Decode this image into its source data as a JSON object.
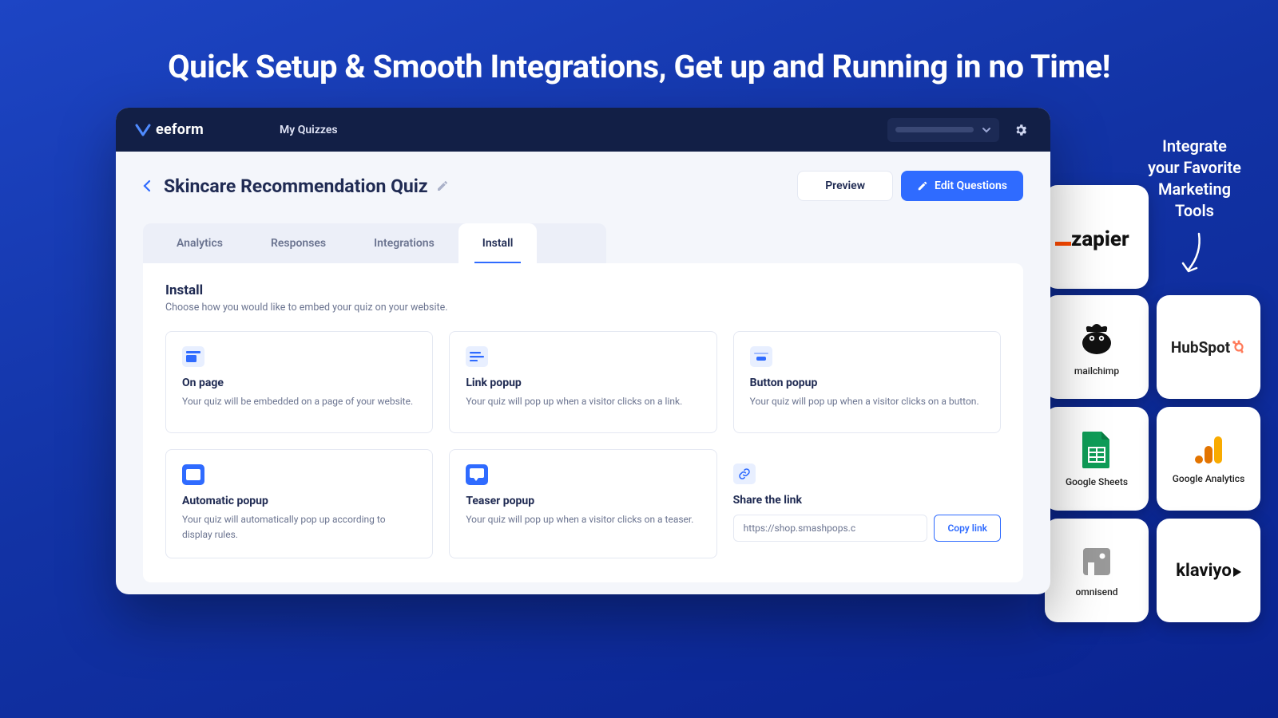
{
  "hero": "Quick Setup & Smooth Integrations, Get up and Running in no Time!",
  "callout": {
    "l1": "Integrate",
    "l2": "your Favorite",
    "l3": "Marketing",
    "l4": "Tools"
  },
  "header": {
    "brand": "eeform",
    "nav": "My Quizzes"
  },
  "title": {
    "text": "Skincare Recommendation Quiz"
  },
  "actions": {
    "preview": "Preview",
    "edit": "Edit Questions"
  },
  "tabs": {
    "analytics": "Analytics",
    "responses": "Responses",
    "integrations": "Integrations",
    "install": "Install"
  },
  "install": {
    "heading": "Install",
    "sub": "Choose how you would like to embed your quiz on your website.",
    "cards": {
      "onpage": {
        "title": "On page",
        "desc": "Your quiz will be embedded on a page of your website."
      },
      "linkpopup": {
        "title": "Link popup",
        "desc": "Your quiz will pop up when a visitor clicks on a link."
      },
      "buttonpopup": {
        "title": "Button popup",
        "desc": "Your quiz will pop up when a visitor clicks on a button."
      },
      "autopopup": {
        "title": "Automatic popup",
        "desc": "Your quiz will automatically pop up according to display rules."
      },
      "teaserpopup": {
        "title": "Teaser popup",
        "desc": "Your quiz will pop up when a visitor clicks on a teaser."
      }
    },
    "share": {
      "title": "Share the link",
      "url": "https://shop.smashpops.c",
      "copy": "Copy link"
    }
  },
  "tools": {
    "zapier": "zapier",
    "mailchimp": "mailchimp",
    "hubspot": "HubSpot",
    "gsheets": "Google Sheets",
    "ganalytics": "Google Analytics",
    "omnisend": "omnisend",
    "klaviyo": "klaviyo"
  }
}
